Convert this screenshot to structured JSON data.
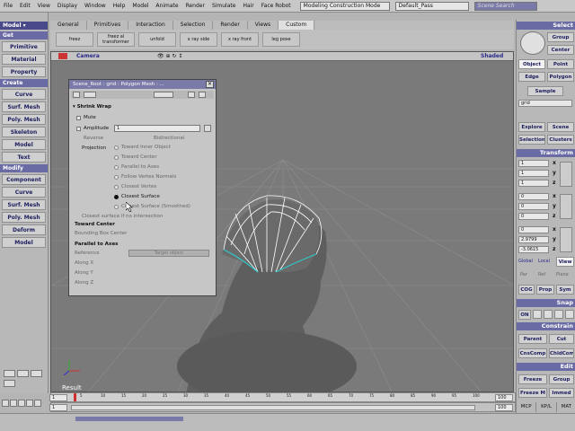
{
  "menubar": {
    "items": [
      "File",
      "Edit",
      "View",
      "Display",
      "Window",
      "Help",
      "Model",
      "Animate",
      "Render",
      "Simulate",
      "Hair",
      "Face Robot"
    ],
    "mode_dropdown": "Modeling Construction Mode",
    "pass_dropdown": "Default_Pass",
    "search_placeholder": "Scene Search"
  },
  "left_panel": {
    "mode": "Model",
    "sections": [
      {
        "title": "Get",
        "items": [
          "Primitive",
          "Material",
          "Property"
        ]
      },
      {
        "title": "Create",
        "items": [
          "Curve",
          "Surf. Mesh",
          "Poly. Mesh",
          "Skeleton",
          "Model",
          "Text"
        ]
      },
      {
        "title": "Modify",
        "items": [
          "Component",
          "Curve",
          "Surf. Mesh",
          "Poly. Mesh",
          "Deform",
          "Model"
        ]
      }
    ]
  },
  "toolbar": {
    "tabs": [
      "General",
      "Primitives",
      "Interaction",
      "Selection",
      "Render",
      "Views",
      "Custom"
    ],
    "active_tab": "Custom",
    "buttons": [
      "freez",
      "freez al transformer",
      "unfold",
      "x ray side",
      "x ray front",
      "leg pose"
    ]
  },
  "viewport": {
    "camera_label": "Camera",
    "shading_label": "Shaded",
    "result_label": "Result"
  },
  "property_editor": {
    "title": "Scene_Root : grid : Polygon Mesh : ...",
    "section": "Shrink Wrap",
    "mute_label": "Mute",
    "amplitude_label": "Amplitude",
    "amplitude_value": "1",
    "reverse_label": "Reverse",
    "bidirectional_label": "Bidirectional",
    "projection_label": "Projection",
    "projection_options": [
      "Toward Inner Object",
      "Toward Center",
      "Parallel to Axes",
      "Follow Vertex Normals",
      "Closest Vertex",
      "Closest Surface",
      "Closest Surface (Smoothed)"
    ],
    "projection_selected": "Closest Surface",
    "closest_surface_note": "Closest surface if no intersection",
    "toward_center_header": "Toward Center",
    "bounding_box_label": "Bounding Box Center",
    "parallel_header": "Parallel to Axes",
    "reference_label": "Reference",
    "reference_value": "Target object",
    "along_x": "Along X",
    "along_y": "Along Y",
    "along_z": "Along Z"
  },
  "right_panel": {
    "select_header": "Select",
    "group_label": "Group",
    "center_label": "Center",
    "object_label": "Object",
    "point_label": "Point",
    "edge_label": "Edge",
    "polygon_label": "Polygon",
    "sample_label": "Sample",
    "name_value": "grid",
    "explore_label": "Explore",
    "scene_label": "Scene",
    "selection_label": "Selection",
    "clusters_label": "Clusters",
    "transform_header": "Transform",
    "scale": [
      "1",
      "1",
      "1"
    ],
    "rotate": [
      "0",
      "0",
      "0"
    ],
    "translate": [
      "0",
      "2.9799",
      "-3.0615"
    ],
    "axis_labels": [
      "x",
      "y",
      "z"
    ],
    "global_label": "Global",
    "local_label": "Local",
    "view_label": "View",
    "par_label": "Par",
    "ref_label": "Ref",
    "plane_label": "Plane",
    "cog_label": "COG",
    "prop_label": "Prop",
    "sym_label": "Sym",
    "snap_header": "Snap",
    "on_label": "ON",
    "constrain_header": "Constrain",
    "parent_label": "Parent",
    "cut_label": "Cut",
    "cnscomp_label": "CnsComp",
    "chldcomp_label": "ChldComp",
    "edit_header": "Edit",
    "freeze_label": "Freeze",
    "group2_label": "Group",
    "freezem_label": "Freeze M",
    "immed_label": "Immed",
    "bottom_tabs": [
      "MCP",
      "KP/L",
      "MAT"
    ]
  },
  "timeline": {
    "start": "1",
    "current": "1",
    "end": "100",
    "end2": "100",
    "ticks": [
      "5",
      "10",
      "15",
      "20",
      "25",
      "30",
      "35",
      "40",
      "45",
      "50",
      "55",
      "60",
      "65",
      "70",
      "75",
      "80",
      "85",
      "90",
      "95",
      "100"
    ]
  },
  "colors": {
    "accent": "#6a6aa4",
    "header_red": "#a84040",
    "viewport_bg": "#7a7a7a",
    "mesh_wire": "#ffffff",
    "mesh_highlight": "#30c8c8"
  }
}
